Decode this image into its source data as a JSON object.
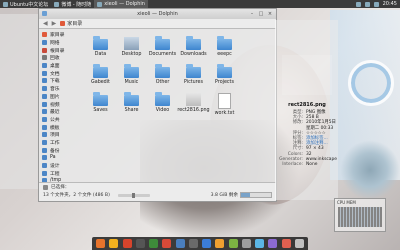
{
  "topbar": {
    "tasks": [
      {
        "label": "Ubuntu中文论坛",
        "active": false
      },
      {
        "label": "微博 - 随时随",
        "active": false
      },
      {
        "label": "xieoli — Dolphin",
        "active": true
      }
    ],
    "clock": "20:45"
  },
  "window": {
    "title": "xieoli — Dolphin",
    "breadcrumb": "家目录"
  },
  "sidebar": {
    "items": [
      {
        "label": "家目录",
        "color": "#e05a3a"
      },
      {
        "label": "网络",
        "color": "#4c86c6"
      },
      {
        "label": "根目录",
        "color": "#c94b3b"
      },
      {
        "label": "回收",
        "color": "#7a7a7a"
      },
      {
        "label": "桌面",
        "color": "#4c86c6"
      },
      {
        "label": "文档",
        "color": "#4c86c6"
      },
      {
        "label": "下载",
        "color": "#4c86c6"
      },
      {
        "label": "音乐",
        "color": "#4c86c6"
      },
      {
        "label": "图片",
        "color": "#4c86c6"
      },
      {
        "label": "视频",
        "color": "#4c86c6"
      },
      {
        "label": "最近",
        "color": "#4c86c6"
      },
      {
        "label": "公共",
        "color": "#4c86c6"
      },
      {
        "label": "模板",
        "color": "#4c86c6"
      },
      {
        "label": "项目",
        "color": "#4c86c6"
      },
      {
        "label": "工作",
        "color": "#4c86c6"
      },
      {
        "label": "备份",
        "color": "#4c86c6"
      },
      {
        "label": "Pa",
        "color": "#4c86c6"
      },
      {
        "label": "设计",
        "color": "#4c86c6"
      },
      {
        "label": "工程",
        "color": "#4c86c6"
      },
      {
        "label": "/tmp",
        "color": "#4c86c6"
      }
    ]
  },
  "files": [
    {
      "name": "Data",
      "kind": "folder"
    },
    {
      "name": "Desktop",
      "kind": "thumb"
    },
    {
      "name": "Documents",
      "kind": "folder"
    },
    {
      "name": "Downloads",
      "kind": "folder"
    },
    {
      "name": "eeepc",
      "kind": "folder"
    },
    {
      "name": "",
      "kind": "none"
    },
    {
      "name": "Gabedit",
      "kind": "folder"
    },
    {
      "name": "Music",
      "kind": "folder"
    },
    {
      "name": "Other",
      "kind": "folder"
    },
    {
      "name": "Pictures",
      "kind": "folder"
    },
    {
      "name": "Projects",
      "kind": "folder"
    },
    {
      "name": "",
      "kind": "none"
    },
    {
      "name": "Saves",
      "kind": "folder"
    },
    {
      "name": "Share",
      "kind": "folder"
    },
    {
      "name": "Video",
      "kind": "folder"
    },
    {
      "name": "rect2816.png",
      "kind": "image"
    },
    {
      "name": "work.txt",
      "kind": "doc"
    },
    {
      "name": "",
      "kind": "none"
    }
  ],
  "statusbar": {
    "message": "已选择：",
    "summary": "13 个文件夹，2 个文件 (486 B)",
    "free": "3.8 GiB 剩余",
    "free_fraction": 0.3
  },
  "info": {
    "filename": "rect2816.png",
    "fields": [
      {
        "k": "类型:",
        "v": "PNG 图像",
        "link": false
      },
      {
        "k": "大小:",
        "v": "258 B",
        "link": false
      },
      {
        "k": "修改:",
        "v": "2010年1月5日",
        "link": false
      },
      {
        "k": "",
        "v": "星期二 00:33",
        "link": false
      },
      {
        "k": "评分:",
        "v": "☆☆☆☆☆",
        "link": false
      },
      {
        "k": "标签:",
        "v": "添加标签...",
        "link": true
      },
      {
        "k": "注释:",
        "v": "添加注释...",
        "link": true
      },
      {
        "k": "尺寸:",
        "v": "97 × 43",
        "link": false
      },
      {
        "k": "Colors:",
        "v": "32",
        "link": false
      },
      {
        "k": "Generator:",
        "v": "www.inkscape",
        "link": false
      },
      {
        "k": "Interlace:",
        "v": "None",
        "link": false
      }
    ]
  },
  "dock": {
    "icons": [
      "#e8742c",
      "#f2b11e",
      "#d7442c",
      "#555",
      "#3e8c3a",
      "#d94a38",
      "#4a7fbf",
      "#6a6a6a",
      "#3b7dd8",
      "#f0a030",
      "#7cb342",
      "#9e9e9e",
      "#5bb6e6",
      "#8c6ad1",
      "#e06050",
      "#c0c0c0"
    ]
  },
  "monitor": {
    "label": "CPU MEM"
  }
}
